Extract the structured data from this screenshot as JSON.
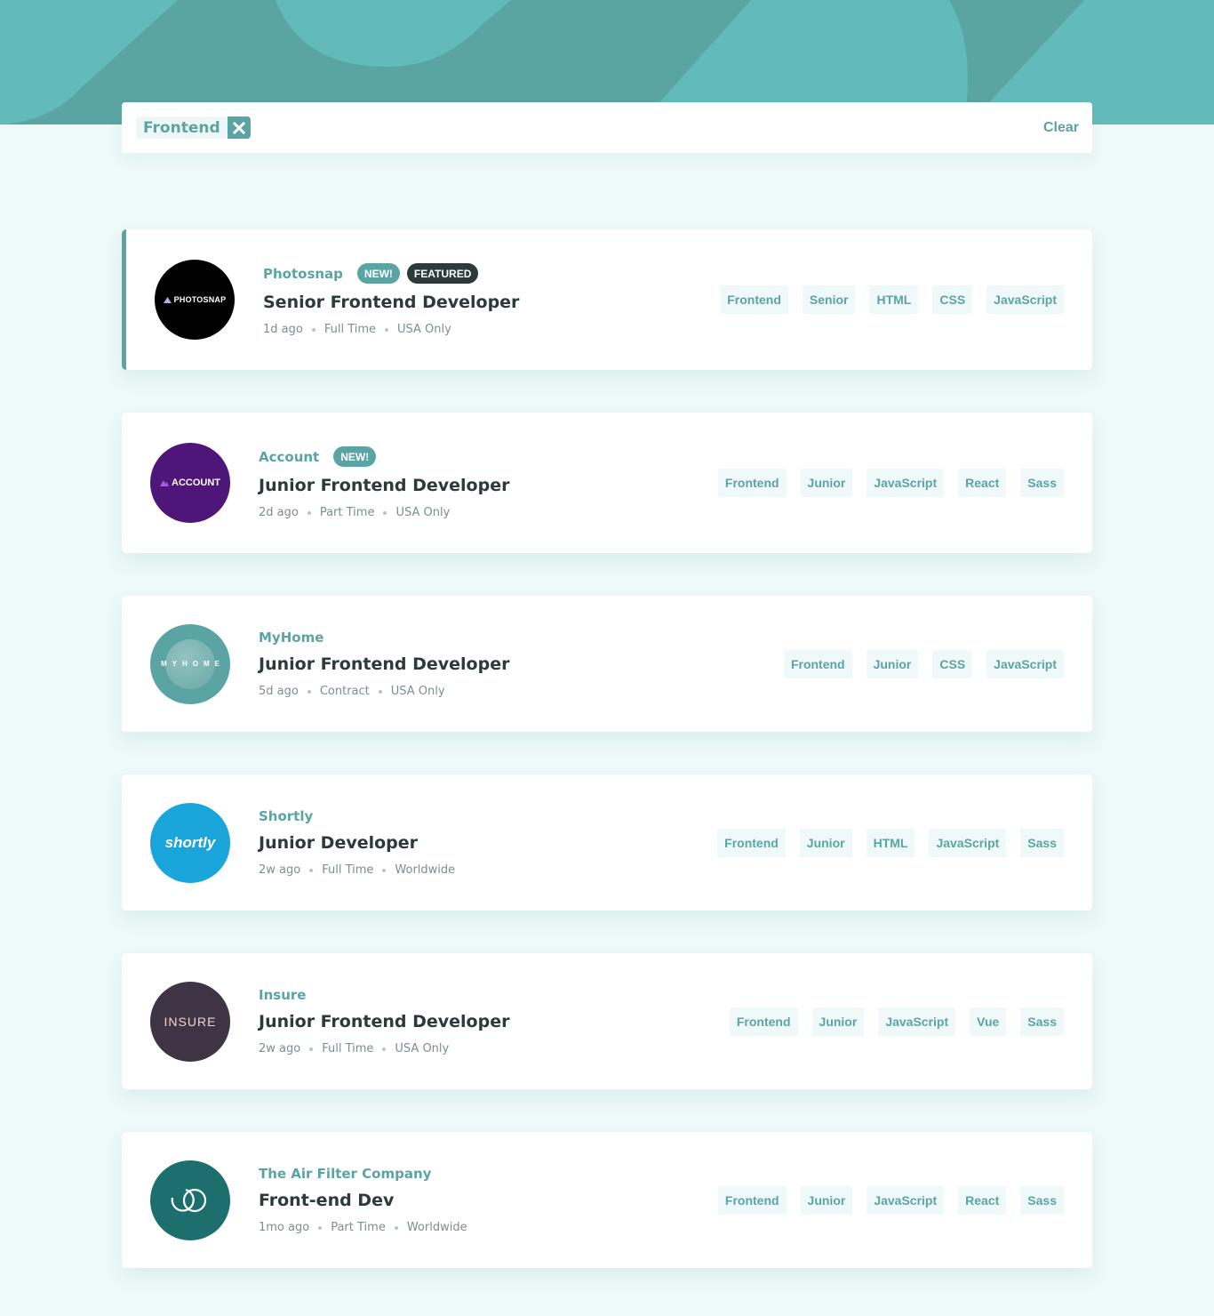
{
  "colors": {
    "primary": "#5ba4a4",
    "header_bg": "#62baba",
    "header_shape": "#5ba4a4",
    "page_bg": "#eef9f9",
    "tag_bg": "#eff9f9",
    "dark": "#2c3a3a",
    "muted": "#7b8e8e"
  },
  "filters": {
    "active": [
      {
        "label": "Frontend",
        "remove_icon": "close-icon"
      }
    ],
    "clear_label": "Clear"
  },
  "jobs": [
    {
      "company": "Photosnap",
      "logo": {
        "text": "PHOTOSNAP",
        "bg": "#000000",
        "icon": "triangle-icon"
      },
      "new": true,
      "featured": true,
      "new_label": "NEW!",
      "featured_label": "FEATURED",
      "position": "Senior Frontend Developer",
      "posted": "1d ago",
      "contract": "Full Time",
      "location": "USA Only",
      "tags": [
        "Frontend",
        "Senior",
        "HTML",
        "CSS",
        "JavaScript"
      ]
    },
    {
      "company": "Account",
      "logo": {
        "text": "ACCOUNT",
        "bg": "#4f1679",
        "icon": "mountain-icon"
      },
      "new": true,
      "featured": false,
      "new_label": "NEW!",
      "position": "Junior Frontend Developer",
      "posted": "2d ago",
      "contract": "Part Time",
      "location": "USA Only",
      "tags": [
        "Frontend",
        "Junior",
        "JavaScript",
        "React",
        "Sass"
      ]
    },
    {
      "company": "MyHome",
      "logo": {
        "text": "MYHOME",
        "bg": "#5ba4a4",
        "icon": ""
      },
      "new": false,
      "featured": false,
      "position": "Junior Frontend Developer",
      "posted": "5d ago",
      "contract": "Contract",
      "location": "USA Only",
      "tags": [
        "Frontend",
        "Junior",
        "CSS",
        "JavaScript"
      ]
    },
    {
      "company": "Shortly",
      "logo": {
        "text": "shortly",
        "bg": "#1aa5db",
        "icon": ""
      },
      "new": false,
      "featured": false,
      "position": "Junior Developer",
      "posted": "2w ago",
      "contract": "Full Time",
      "location": "Worldwide",
      "tags": [
        "Frontend",
        "Junior",
        "HTML",
        "JavaScript",
        "Sass"
      ]
    },
    {
      "company": "Insure",
      "logo": {
        "text": "INSURE",
        "bg": "#3f3443",
        "icon": ""
      },
      "new": false,
      "featured": false,
      "position": "Junior Frontend Developer",
      "posted": "2w ago",
      "contract": "Full Time",
      "location": "USA Only",
      "tags": [
        "Frontend",
        "Junior",
        "JavaScript",
        "Vue",
        "Sass"
      ]
    },
    {
      "company": "The Air Filter Company",
      "logo": {
        "text": "",
        "bg": "#1c6f6d",
        "icon": "rings-icon"
      },
      "new": false,
      "featured": false,
      "position": "Front-end Dev",
      "posted": "1mo ago",
      "contract": "Part Time",
      "location": "Worldwide",
      "tags": [
        "Frontend",
        "Junior",
        "JavaScript",
        "React",
        "Sass"
      ]
    }
  ]
}
